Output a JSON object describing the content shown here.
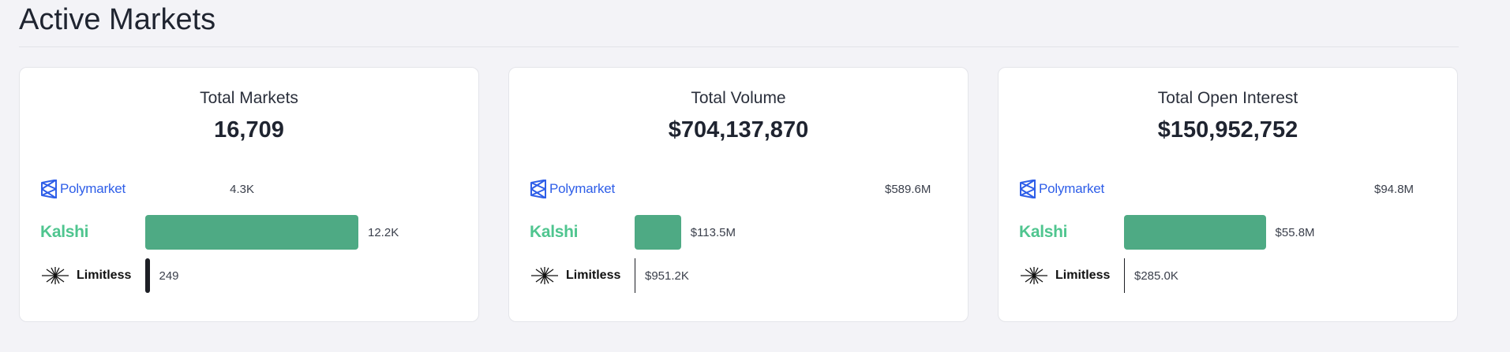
{
  "page": {
    "title": "Active Markets"
  },
  "colors": {
    "polymarket": "#4a82f7",
    "kalshi": "#4eaa84",
    "limitless": "#1d1f25"
  },
  "platforms": {
    "polymarket": {
      "name": "Polymarket",
      "icon": "polymarket-logo-icon"
    },
    "kalshi": {
      "name": "Kalshi"
    },
    "limitless": {
      "name": "Limitless",
      "icon": "limitless-star-icon"
    }
  },
  "cards": [
    {
      "title": "Total Markets",
      "total": "16,709",
      "rows": [
        {
          "platform": "polymarket",
          "value": 4300,
          "label": "4.3K"
        },
        {
          "platform": "kalshi",
          "value": 12200,
          "label": "12.2K"
        },
        {
          "platform": "limitless",
          "value": 249,
          "label": "249"
        }
      ]
    },
    {
      "title": "Total Volume",
      "total": "$704,137,870",
      "rows": [
        {
          "platform": "polymarket",
          "value": 589.6,
          "label": "$589.6M"
        },
        {
          "platform": "kalshi",
          "value": 113.5,
          "label": "$113.5M"
        },
        {
          "platform": "limitless",
          "value": 0.9512,
          "label": "$951.2K"
        }
      ]
    },
    {
      "title": "Total Open Interest",
      "total": "$150,952,752",
      "rows": [
        {
          "platform": "polymarket",
          "value": 94.8,
          "label": "$94.8M"
        },
        {
          "platform": "kalshi",
          "value": 55.8,
          "label": "$55.8M"
        },
        {
          "platform": "limitless",
          "value": 0.285,
          "label": "$285.0K"
        }
      ]
    }
  ]
}
